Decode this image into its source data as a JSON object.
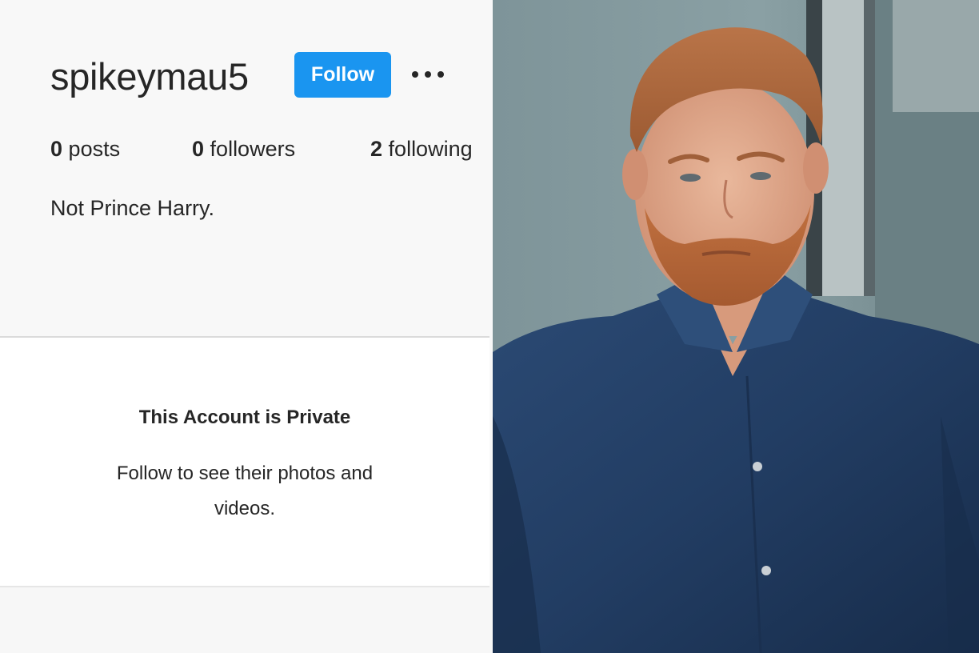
{
  "profile": {
    "username": "spikeymau5",
    "follow_label": "Follow",
    "more_icon": "more-horizontal-icon",
    "stats": {
      "posts_count": "0",
      "posts_label": "posts",
      "followers_count": "0",
      "followers_label": "followers",
      "following_count": "2",
      "following_label": "following"
    },
    "bio": "Not Prince Harry.",
    "private_notice": {
      "title": "This Account is Private",
      "subtitle": "Follow to see their photos and videos."
    }
  },
  "photo": {
    "subject": "man-in-navy-shirt-photo"
  },
  "colors": {
    "accent": "#1a95f0",
    "text": "#262626",
    "panel_bg": "#f8f8f8",
    "card_bg": "#ffffff",
    "shirt": "#223d63",
    "hair": "#b0683a"
  }
}
